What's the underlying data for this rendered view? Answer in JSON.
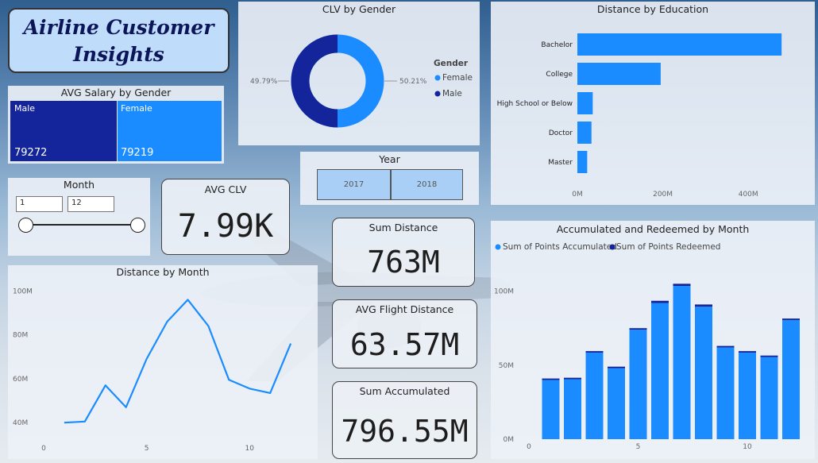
{
  "title": {
    "line1": "Airline Customer",
    "line2": "Insights"
  },
  "colors": {
    "female": "#1a8cff",
    "male": "#14259c",
    "bar": "#1a8cff",
    "redeemed": "#14259c"
  },
  "salary": {
    "title": "AVG Salary by Gender",
    "male": {
      "label": "Male",
      "value": "79272"
    },
    "female": {
      "label": "Female",
      "value": "79219"
    }
  },
  "month_filter": {
    "title": "Month",
    "from": "1",
    "to": "12"
  },
  "year_filter": {
    "title": "Year",
    "options": [
      "2017",
      "2018"
    ]
  },
  "kpis": {
    "avg_clv": {
      "title": "AVG CLV",
      "value": "7.99K"
    },
    "sum_distance": {
      "title": "Sum Distance",
      "value": "763M"
    },
    "avg_flight": {
      "title": "AVG Flight Distance",
      "value": "63.57M"
    },
    "sum_accumulated": {
      "title": "Sum Accumulated",
      "value": "796.55M"
    }
  },
  "chart_data": [
    {
      "type": "pie",
      "title": "CLV by Gender",
      "legend_title": "Gender",
      "legend_position": "right",
      "slices": [
        {
          "name": "Female",
          "value": 50.21,
          "label": "50.21%"
        },
        {
          "name": "Male",
          "value": 49.79,
          "label": "49.79%"
        }
      ]
    },
    {
      "type": "bar",
      "title": "Distance by Education",
      "orientation": "horizontal",
      "categories": [
        "Bachelor",
        "College",
        "High School or Below",
        "Doctor",
        "Master"
      ],
      "values": [
        478,
        195,
        36,
        33,
        23
      ],
      "xlim": [
        0,
        500
      ],
      "x_ticks": [
        "0M",
        "200M",
        "400M"
      ]
    },
    {
      "type": "line",
      "title": "Distance by Month",
      "x": [
        1,
        2,
        3,
        4,
        5,
        6,
        7,
        8,
        9,
        10,
        11,
        12
      ],
      "values": [
        40,
        40.5,
        57,
        47,
        69,
        86,
        96,
        84,
        59.5,
        55.5,
        53.5,
        76
      ],
      "xlim": [
        0,
        13
      ],
      "ylim": [
        35,
        103
      ],
      "x_ticks": [
        "0",
        "5",
        "10"
      ],
      "y_ticks": [
        "40M",
        "60M",
        "80M",
        "100M"
      ]
    },
    {
      "type": "bar",
      "title": "Accumulated and Redeemed by Month",
      "legend_position": "top-left",
      "x": [
        1,
        2,
        3,
        4,
        5,
        6,
        7,
        8,
        9,
        10,
        11,
        12
      ],
      "series": [
        {
          "name": "Sum of Points Accumulated",
          "values": [
            40,
            40.5,
            58.5,
            48,
            74,
            92,
            103.5,
            89.5,
            62,
            58.5,
            55.5,
            80.5
          ]
        },
        {
          "name": "Sum of Points Redeemed",
          "values": [
            1,
            1,
            1,
            1,
            1,
            1.5,
            1.5,
            1.5,
            1,
            1,
            1,
            1
          ]
        }
      ],
      "ylim": [
        0,
        110
      ],
      "x_ticks": [
        "0",
        "5",
        "10"
      ],
      "y_ticks": [
        "0M",
        "50M",
        "100M"
      ]
    }
  ]
}
